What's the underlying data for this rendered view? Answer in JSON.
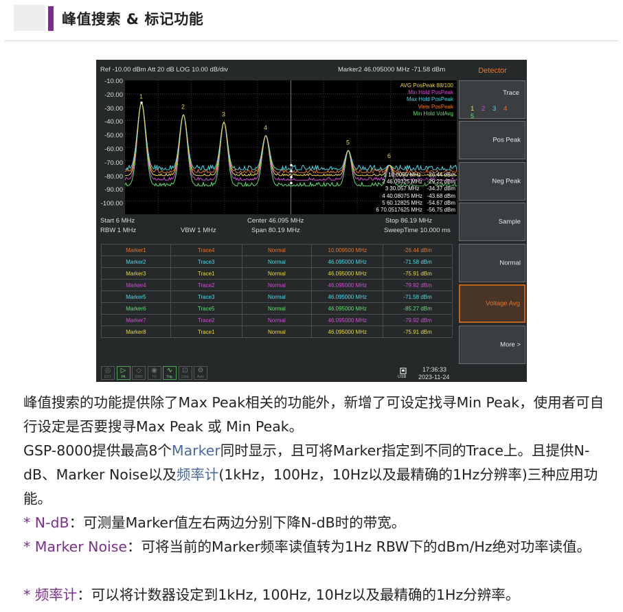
{
  "header": {
    "title": "峰值搜索 & 标记功能"
  },
  "instrument": {
    "top_left": "Ref -10.00 dBm  Att 20 dB  LOG 10.00 dB/div",
    "top_right": "Marker2 46.095000 MHz   -71.58 dBm",
    "y_labels": [
      "-10.00",
      "-20.00",
      "-30.00",
      "-40.00",
      "-50.00",
      "-60.00",
      "-70.00",
      "-80.00",
      "-90.00",
      "-100.00"
    ],
    "trace_legend": [
      {
        "label": "AVG PosPeak 88/100",
        "color": "#e8d64a"
      },
      {
        "label": "Min Hold PosPeak",
        "color": "#d24fd6"
      },
      {
        "label": "Max Hold PosPeak",
        "color": "#4fd8e6"
      },
      {
        "label": "View PosPeak",
        "color": "#e8752a"
      },
      {
        "label": "Min Hold VolAvg",
        "color": "#5fe070"
      }
    ],
    "peak_labels": [
      "1",
      "2",
      "3",
      "4",
      "5",
      "6"
    ],
    "marker_readout": [
      "1 10.0095 MHz    -26.44 dBm",
      "2 46.09325 MHz   -29.22 dBm",
      "3 30.057 MHz     -34.37 dBm",
      "4 40.08075 MHz   -43.68 dBm",
      "5 60.12825 MHz   -54.67 dBm",
      "6 70.0517625 MHz   -56.75 dBm"
    ],
    "start": "Start 6 MHz",
    "center": "Center 46.095 MHz",
    "stop": "Stop 86.19 MHz",
    "rbw": "RBW 1 MHz",
    "vbw": "VBW 1 MHz",
    "span": "Span 80.19 MHz",
    "sweep": "SweepTime 10.000 ms",
    "markers": [
      {
        "name": "Marker1",
        "trace": "Trace4",
        "mode": "Normal",
        "freq": "10.009500 MHz",
        "level": "-26.44 dBm",
        "color": "#e8752a"
      },
      {
        "name": "Marker2",
        "trace": "Trace3",
        "mode": "Normal",
        "freq": "46.095000 MHz",
        "level": "-71.58 dBm",
        "color": "#4fd8e6"
      },
      {
        "name": "Marker3",
        "trace": "Trace1",
        "mode": "Normal",
        "freq": "46.095000 MHz",
        "level": "-75.91 dBm",
        "color": "#e8d64a"
      },
      {
        "name": "Marker4",
        "trace": "Trace2",
        "mode": "Normal",
        "freq": "46.095000 MHz",
        "level": "-79.92 dBm",
        "color": "#d24fd6"
      },
      {
        "name": "Marker5",
        "trace": "Trace3",
        "mode": "Normal",
        "freq": "46.095000 MHz",
        "level": "-71.58 dBm",
        "color": "#4fd8e6"
      },
      {
        "name": "Marker6",
        "trace": "Trace5",
        "mode": "Normal",
        "freq": "46.095000 MHz",
        "level": "-85.27 dBm",
        "color": "#5fe070"
      },
      {
        "name": "Marker7",
        "trace": "Trace2",
        "mode": "Normal",
        "freq": "46.095000 MHz",
        "level": "-79.92 dBm",
        "color": "#d24fd6"
      },
      {
        "name": "Marker8",
        "trace": "Trace1",
        "mode": "Normal",
        "freq": "46.095000 MHz",
        "level": "-75.91 dBm",
        "color": "#e8d64a"
      }
    ],
    "softkeys": {
      "header": "Detector",
      "trace_label": "Trace",
      "trace_numbers": [
        "1",
        "2",
        "3",
        "4",
        "5"
      ],
      "trace_number_colors": [
        "#e8d64a",
        "#d24fd6",
        "#4fd8e6",
        "#e8752a",
        "#5fe070"
      ],
      "pos_peak": "Pos Peak",
      "neg_peak": "Neg Peak",
      "sample": "Sample",
      "normal": "Normal",
      "voltage_avg": "Voltage Avg",
      "more": "More  >"
    },
    "status_icons": [
      {
        "label": "EXT",
        "icon": "ext-icon",
        "active": false
      },
      {
        "label": "PA",
        "icon": "pa-icon",
        "active": true
      },
      {
        "label": "SWR",
        "icon": "swr-icon",
        "active": false
      },
      {
        "label": "TG",
        "icon": "tg-icon",
        "active": false
      },
      {
        "label": "Trig.",
        "icon": "trigger-icon",
        "active": true
      },
      {
        "label": "Cont.",
        "icon": "continuous-icon",
        "active": false
      },
      {
        "label": "Auto",
        "icon": "auto-icon",
        "active": false
      }
    ],
    "usb_label": "USB",
    "time": "17:36:33",
    "date": "2023-11-24"
  },
  "body": {
    "p1": "峰值搜索的功能提供除了Max Peak相关的功能外，新增了可设定找寻Min Peak，使用者可自行设定是否要搜寻Max Peak 或 Min Peak。",
    "p2_a": "GSP-8000提供最高8个",
    "p2_link1": "Marker",
    "p2_b": "同时显示，且可将Marker指定到不同的Trace上。且提供N-dB、Marker Noise以及",
    "p2_link2": "频率计",
    "p2_c": "(1kHz，100Hz，10Hz以及最精确的1Hz分辨率)三种应用功能。",
    "b1_term": "* N-dB",
    "b1_text": "：可测量Marker值左右两边分别下降N-dB时的带宽。",
    "b2_term": "* Marker Noise",
    "b2_text": "：可将当前的Marker频率读值转为1Hz RBW下的dBm/Hz绝对功率读值。",
    "b3_term": "* 频率计",
    "b3_text": "：可以将计数器设定到1kHz, 100Hz, 10Hz以及最精确的1Hz分辨率。"
  }
}
